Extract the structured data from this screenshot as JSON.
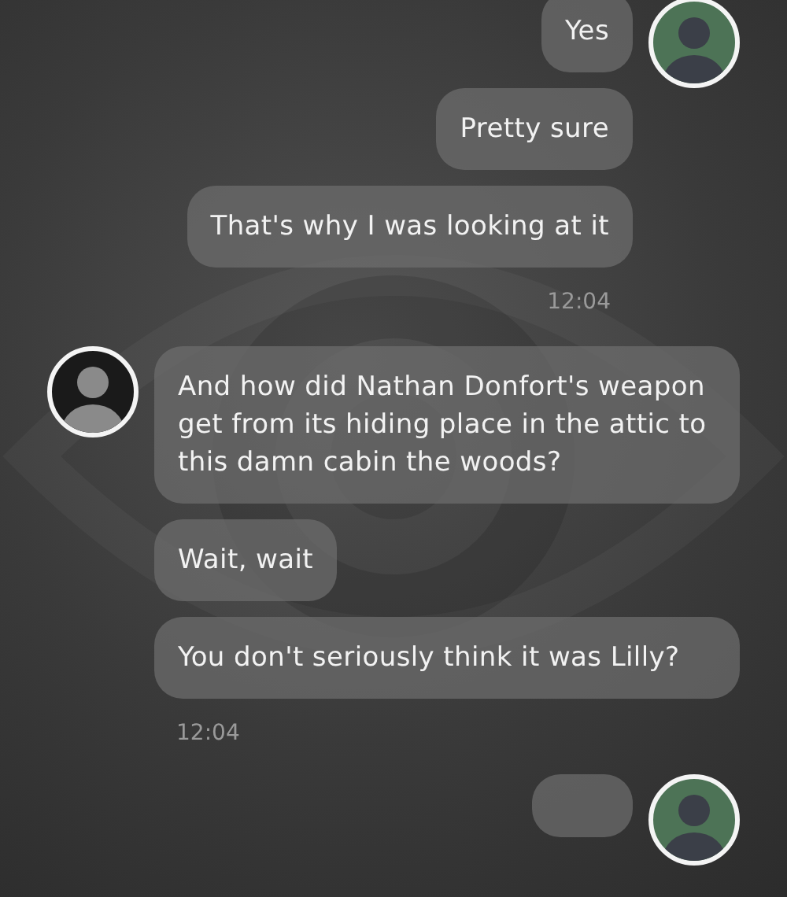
{
  "groups": [
    {
      "kind": "outgoing",
      "messages": [
        "Yes",
        "Pretty sure",
        "That's why I was looking at it"
      ],
      "time": "12:04"
    },
    {
      "kind": "incoming",
      "messages": [
        "And how did Nathan Donfort's weapon get from its hiding place in the attic to this damn cabin the woods?",
        "Wait, wait",
        "You don't seriously think it was Lilly?"
      ],
      "time": "12:04"
    },
    {
      "kind": "outgoing",
      "cut_off": true
    }
  ]
}
